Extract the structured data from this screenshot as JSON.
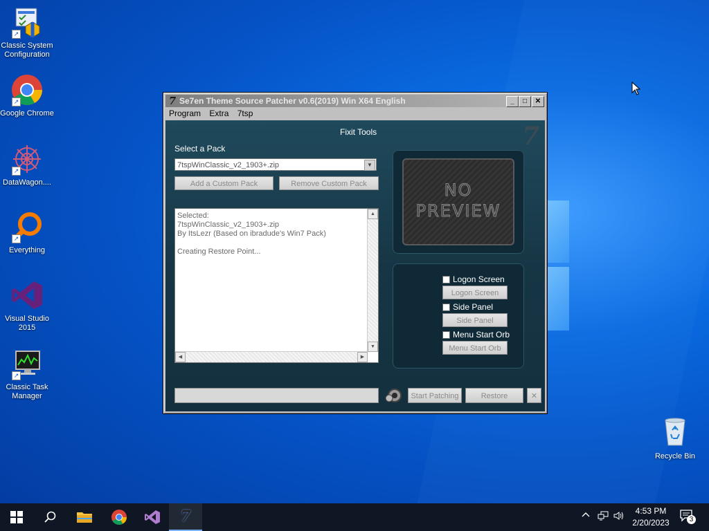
{
  "desktop": {
    "icons": [
      {
        "label": "Classic System Configuration"
      },
      {
        "label": "Google Chrome"
      },
      {
        "label": "DataWagon...."
      },
      {
        "label": "Everything"
      },
      {
        "label": "Visual Studio 2015"
      },
      {
        "label": "Classic Task Manager"
      }
    ],
    "recycle_bin": "Recycle Bin"
  },
  "window": {
    "title": "Se7en Theme Source Patcher v0.6(2019) Win X64 English",
    "icon_glyph": "7",
    "menu": [
      "Program",
      "Extra",
      "7tsp"
    ],
    "section_title": "Fixit Tools",
    "select_pack_label": "Select a Pack",
    "selected_pack": "7tspWinClassic_v2_1903+.zip",
    "add_pack_button": "Add a Custom Pack",
    "remove_pack_button": "Remove Custom Pack",
    "log_text": "Selected:\n7tspWinClassic_v2_1903+.zip\nBy ItsLezr (Based on ibradude's Win7 Pack)\n\nCreating Restore Point...",
    "preview_line1": "NO",
    "preview_line2": "PREVIEW",
    "options": [
      {
        "label": "Logon Screen",
        "button": "Logon Screen"
      },
      {
        "label": "Side Panel",
        "button": "Side Panel"
      },
      {
        "label": "Menu Start Orb",
        "button": "Menu Start Orb"
      }
    ],
    "start_patching_button": "Start Patching",
    "restore_button": "Restore",
    "close_x": "✕",
    "logo": "7"
  },
  "taskbar": {
    "time": "4:53 PM",
    "date": "2/20/2023",
    "notification_count": "3"
  },
  "colors": {
    "desktop_accent": "#0a6ae0",
    "taskbar": "#0f1724"
  }
}
